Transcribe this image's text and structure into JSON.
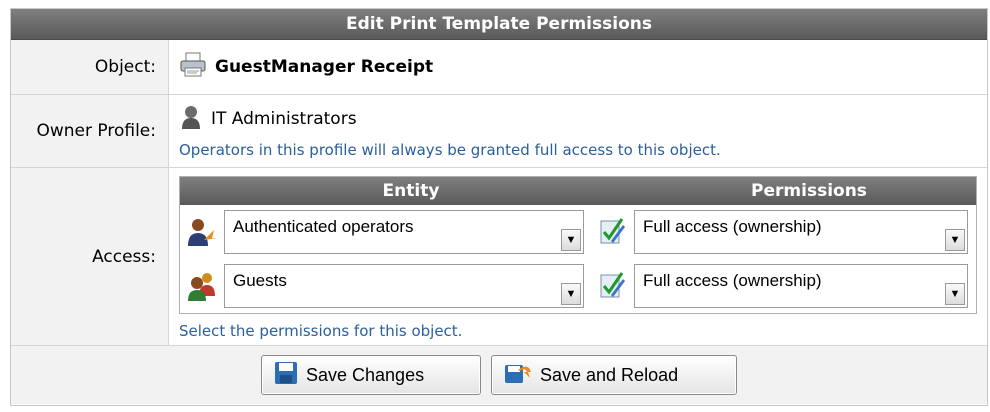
{
  "title": "Edit Print Template Permissions",
  "object": {
    "label": "Object:",
    "name": "GuestManager Receipt",
    "icon": "printer-icon"
  },
  "owner": {
    "label": "Owner Profile:",
    "name": "IT Administrators",
    "icon": "admin-profile-icon",
    "hint": "Operators in this profile will always be granted full access to this object."
  },
  "access": {
    "label": "Access:",
    "columns": {
      "entity": "Entity",
      "permissions": "Permissions"
    },
    "rows": [
      {
        "icon": "authenticated-operators-icon",
        "entity": "Authenticated operators",
        "permission": "Full access (ownership)"
      },
      {
        "icon": "guests-icon",
        "entity": "Guests",
        "permission": "Full access (ownership)"
      }
    ],
    "hint": "Select the permissions for this object."
  },
  "buttons": {
    "save": "Save Changes",
    "save_reload": "Save and Reload"
  }
}
